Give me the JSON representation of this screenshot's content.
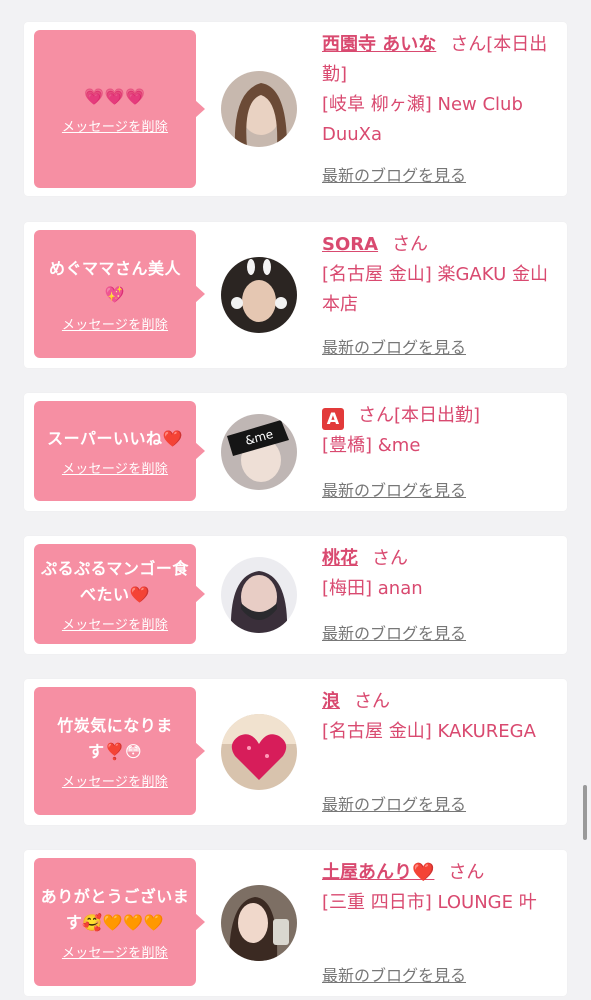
{
  "delete_label": "メッセージを削除",
  "blog_label": "最新のブログを見る",
  "san": "さん",
  "colors": {
    "accent": "#d94a70",
    "bubble": "#f68fa3",
    "blog": "#777777"
  },
  "cards": [
    {
      "message": "💗💗💗",
      "name": "西園寺 あいな",
      "status": "[本日出勤]",
      "shop": "[岐阜 柳ヶ瀬] New Club DuuXa",
      "avatar_icon": "woman-portrait"
    },
    {
      "message": "めぐママさん美人💖",
      "name": "SORA",
      "status": "",
      "shop": "[名古屋 金山] 楽GAKU 金山本店",
      "avatar_icon": "bunny-filter-portrait"
    },
    {
      "message": "スーパーいいね❤️",
      "name": "A",
      "status": "[本日出勤]",
      "shop": "[豊橋] &me",
      "avatar_icon": "andme-portrait"
    },
    {
      "message": "ぷるぷるマンゴー食べたい❤️",
      "name": "桃花",
      "status": "",
      "shop": "[梅田] anan",
      "avatar_icon": "masked-woman-portrait"
    },
    {
      "message": "竹炭気になります❣️😳",
      "name": "浪",
      "status": "",
      "shop": "[名古屋 金山] KAKUREGA",
      "avatar_icon": "heart-sparkle-portrait"
    },
    {
      "message": "ありがとうございます🥰🧡🧡🧡",
      "name": "土屋あんり❤️",
      "status": "",
      "shop": "[三重 四日市] LOUNGE 叶",
      "avatar_icon": "drink-portrait"
    }
  ]
}
